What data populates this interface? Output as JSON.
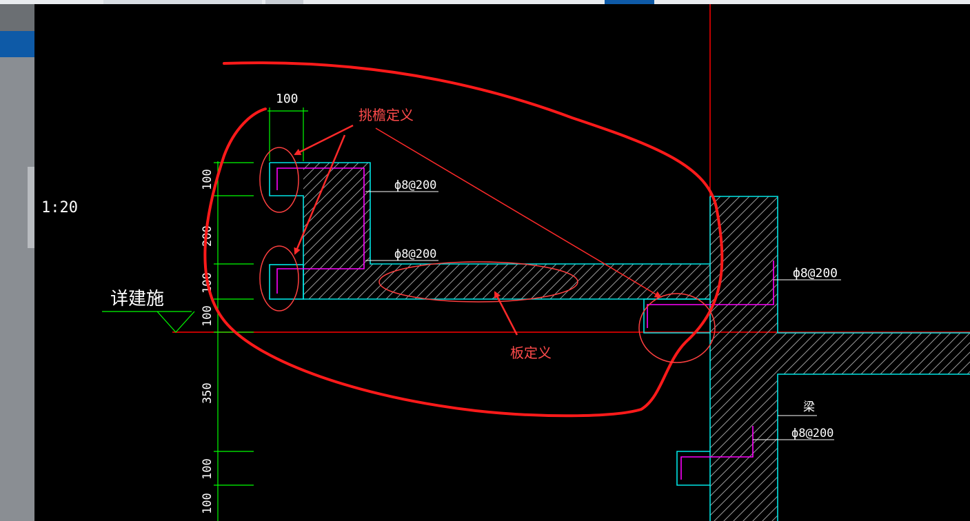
{
  "drawing": {
    "scale_label": "1:20",
    "detail_note": "详建施",
    "dims_top": [
      "100"
    ],
    "dims_left": [
      "100",
      "200",
      "100",
      "100",
      "350",
      "100",
      "100"
    ],
    "rebar": [
      "ф8@200",
      "ф8@200",
      "ф8@200",
      "ф8@200"
    ],
    "beam_label": "梁"
  },
  "annotations": {
    "eave_label": "挑檐定义",
    "slab_label": "板定义"
  },
  "colors": {
    "background": "#000000",
    "outline": "#00e5e5",
    "dimension": "#00ff00",
    "rebar": "#ff00ff",
    "axis": "#ff0000",
    "markup": "#ff1a1a",
    "markup_text": "#ff4b4b"
  }
}
